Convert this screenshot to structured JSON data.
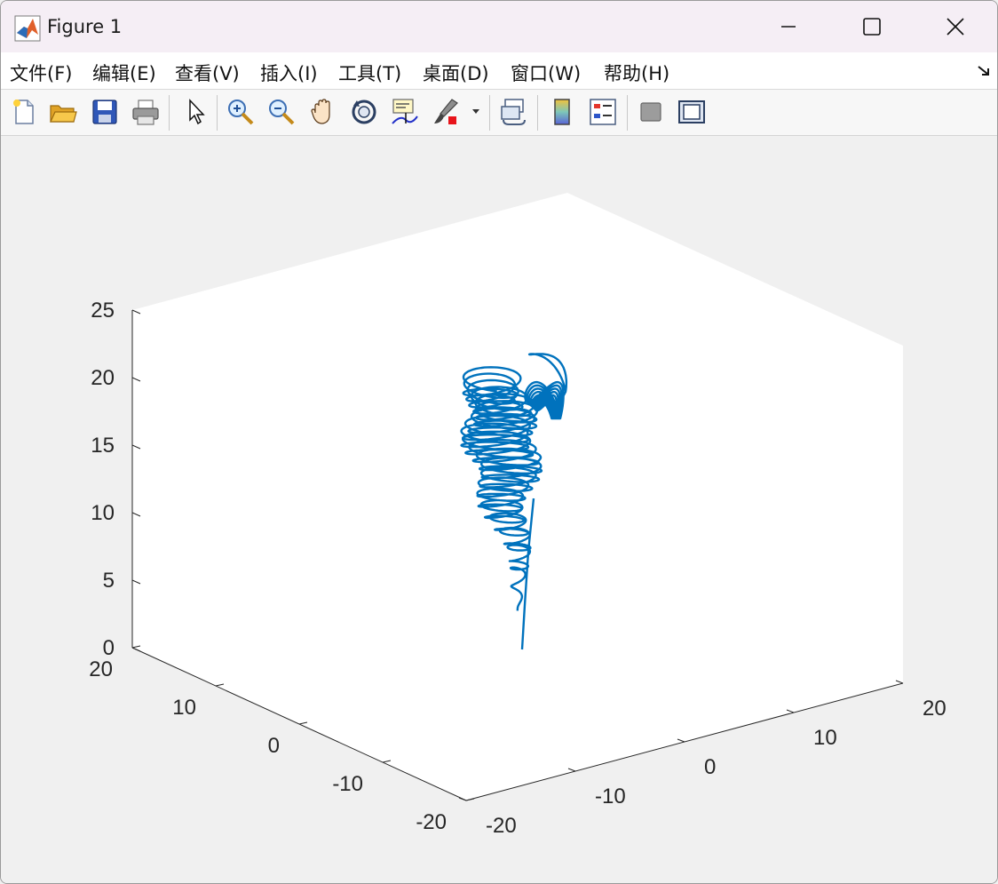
{
  "window": {
    "title": "Figure 1"
  },
  "menu": {
    "items": [
      "文件(F)",
      "编辑(E)",
      "查看(V)",
      "插入(I)",
      "工具(T)",
      "桌面(D)",
      "窗口(W)",
      "帮助(H)"
    ],
    "corner_icon": "dock-arrow-icon"
  },
  "toolbar": {
    "buttons": [
      "new-figure-icon",
      "open-file-icon",
      "save-icon",
      "print-icon",
      "edit-plot-arrow-icon",
      "zoom-in-icon",
      "zoom-out-icon",
      "pan-hand-icon",
      "rotate-3d-icon",
      "data-cursor-icon",
      "brush-icon",
      "link-plot-icon",
      "colorbar-icon",
      "legend-icon",
      "hide-plot-tools-icon",
      "show-plot-tools-icon"
    ]
  },
  "colors": {
    "curve": "#0072BD",
    "axis": "#262626",
    "plot_bg": "#ffffff",
    "figure_bg": "#f0f0f0"
  },
  "chart_data": {
    "type": "line",
    "title": "",
    "xlabel": "",
    "ylabel": "",
    "zlabel": "",
    "xlim": [
      -20,
      20
    ],
    "ylim": [
      -20,
      20
    ],
    "zlim": [
      0,
      25
    ],
    "view": "3d",
    "grid": false,
    "z_ticks": [
      "0",
      "5",
      "10",
      "15",
      "20",
      "25"
    ],
    "left_axis_ticks": [
      "20",
      "10",
      "0",
      "-10",
      "-20"
    ],
    "right_axis_ticks": [
      "-20",
      "-10",
      "0",
      "10",
      "20"
    ],
    "series": [
      {
        "description_points": [
          [
            -1.0,
            -2.0,
            1.0
          ],
          [
            -4.0,
            -3.0,
            8.0
          ],
          [
            -6.5,
            -4.0,
            15.0
          ],
          [
            -6.0,
            -3.5,
            18.5
          ],
          [
            -3.0,
            -1.0,
            18.5
          ],
          [
            0.5,
            1.5,
            17.0
          ],
          [
            4.0,
            4.0,
            20.5
          ],
          [
            5.5,
            5.0,
            23.0
          ],
          [
            4.5,
            4.0,
            17.0
          ],
          [
            2.0,
            2.0,
            9.0
          ]
        ]
      }
    ]
  }
}
